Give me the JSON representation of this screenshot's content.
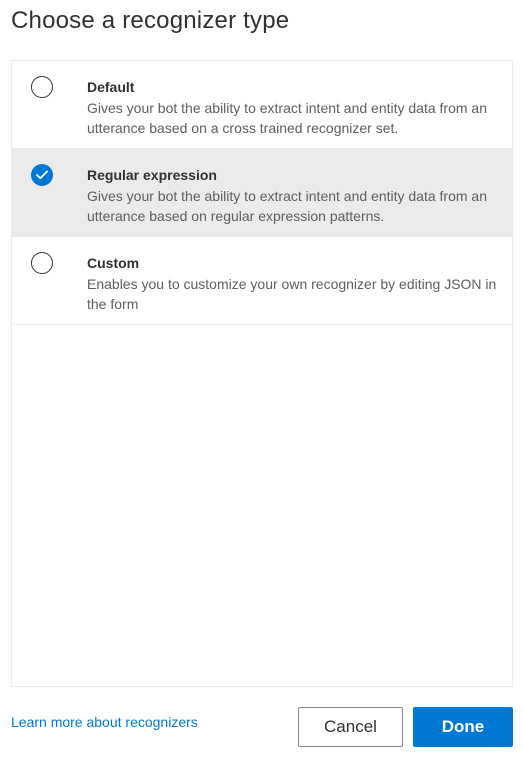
{
  "dialog": {
    "title": "Choose a recognizer type"
  },
  "options": [
    {
      "title": "Default",
      "description": "Gives your bot the ability to extract intent and entity data from an utterance based on a cross trained recognizer set.",
      "selected": false
    },
    {
      "title": "Regular expression",
      "description": "Gives your bot the ability to extract intent and entity data from an utterance based on regular expression patterns.",
      "selected": true
    },
    {
      "title": "Custom",
      "description": "Enables you to customize your own recognizer by editing JSON in the form",
      "selected": false
    }
  ],
  "footer": {
    "learn_more": "Learn more about recognizers",
    "cancel_label": "Cancel",
    "done_label": "Done"
  },
  "colors": {
    "accent": "#0078d4",
    "selected_background": "#ebebeb",
    "border": "#edebe9"
  },
  "icons": {
    "checked_radio": "checkmark-icon"
  }
}
